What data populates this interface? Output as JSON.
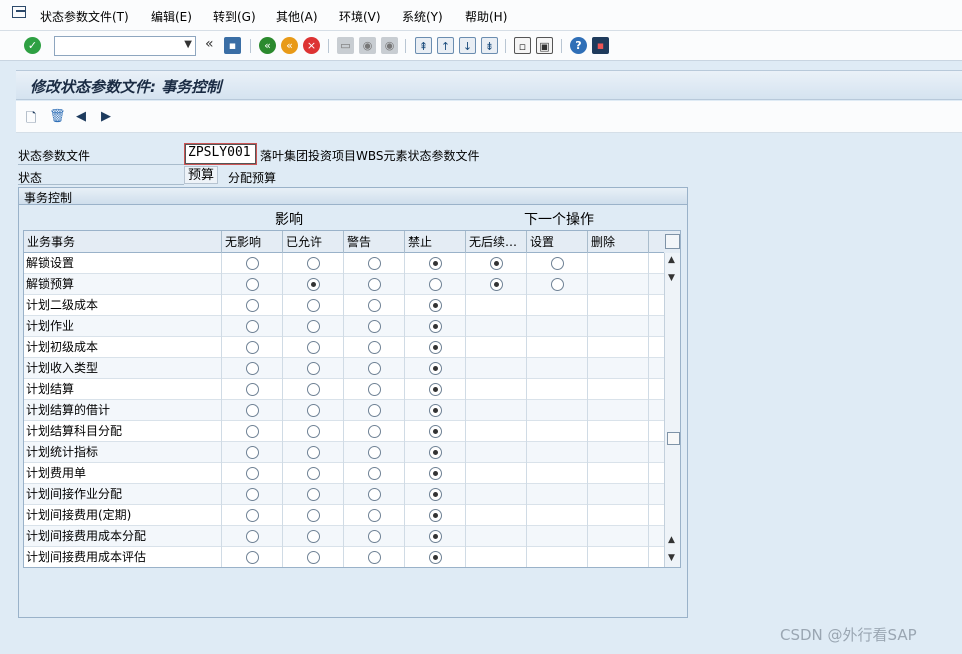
{
  "menu": {
    "items": [
      "状态参数文件(T)",
      "编辑(E)",
      "转到(G)",
      "其他(A)",
      "环境(V)",
      "系统(Y)",
      "帮助(H)"
    ]
  },
  "toolbar": {
    "command_value": "",
    "icons": [
      "enter-icon",
      "command-field",
      "save-icon",
      "back-icon",
      "exit-icon",
      "cancel-icon",
      "print-icon",
      "find-icon",
      "find-next-icon",
      "first-page-icon",
      "prev-page-icon",
      "next-page-icon",
      "last-page-icon",
      "new-session-icon",
      "shortcut-icon",
      "help-icon",
      "layout-icon"
    ]
  },
  "title": "修改状态参数文件: 事务控制",
  "app_toolbar": {
    "icons": [
      "new-entry-icon",
      "delete-icon",
      "previous-icon",
      "next-icon"
    ]
  },
  "form": {
    "profile_label": "状态参数文件",
    "profile_value": "ZPSLY001",
    "profile_desc": "落叶集团投资项目WBS元素状态参数文件",
    "status_label": "状态",
    "status_value": "预算",
    "status_desc": "分配预算"
  },
  "group": {
    "title": "事务控制",
    "influence_label": "影响",
    "next_action_label": "下一个操作"
  },
  "table": {
    "columns": [
      "业务事务",
      "无影响",
      "已允许",
      "警告",
      "禁止",
      "无后续…",
      "设置",
      "删除"
    ],
    "rows": [
      {
        "name": "解锁设置",
        "influence": 3,
        "next": 0
      },
      {
        "name": "解锁预算",
        "influence": 1,
        "next": 0
      },
      {
        "name": "计划二级成本",
        "influence": 3,
        "next": -1
      },
      {
        "name": "计划作业",
        "influence": 3,
        "next": -1
      },
      {
        "name": "计划初级成本",
        "influence": 3,
        "next": -1
      },
      {
        "name": "计划收入类型",
        "influence": 3,
        "next": -1
      },
      {
        "name": "计划结算",
        "influence": 3,
        "next": -1
      },
      {
        "name": "计划结算的借计",
        "influence": 3,
        "next": -1
      },
      {
        "name": "计划结算科目分配",
        "influence": 3,
        "next": -1
      },
      {
        "name": "计划统计指标",
        "influence": 3,
        "next": -1
      },
      {
        "name": "计划费用单",
        "influence": 3,
        "next": -1
      },
      {
        "name": "计划间接作业分配",
        "influence": 3,
        "next": -1
      },
      {
        "name": "计划间接费用(定期)",
        "influence": 3,
        "next": -1
      },
      {
        "name": "计划间接费用成本分配",
        "influence": 3,
        "next": -1
      },
      {
        "name": "计划间接费用成本评估",
        "influence": 3,
        "next": -1
      }
    ]
  },
  "watermark": "CSDN @外行看SAP"
}
